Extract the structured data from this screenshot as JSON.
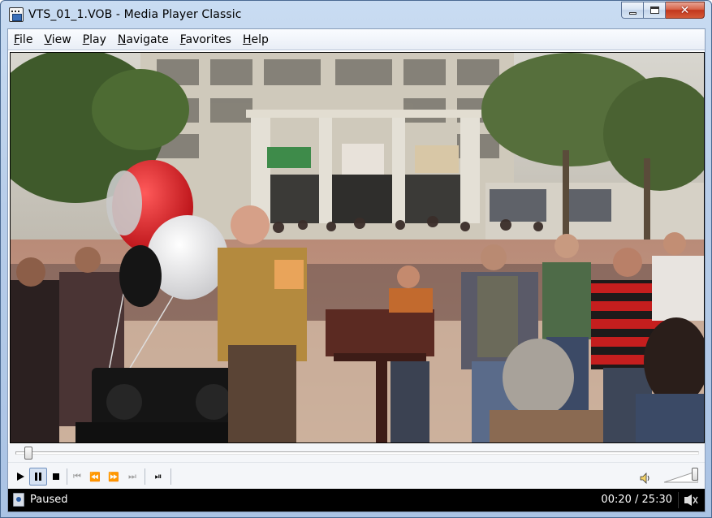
{
  "window": {
    "title": "VTS_01_1.VOB - Media Player Classic"
  },
  "menu": [
    {
      "label_acc": "F",
      "label_rest": "ile"
    },
    {
      "label_acc": "V",
      "label_rest": "iew"
    },
    {
      "label_acc": "P",
      "label_rest": "lay"
    },
    {
      "label_acc": "N",
      "label_rest": "avigate"
    },
    {
      "label_acc": "F",
      "label_rest": "avorites"
    },
    {
      "label_acc": "H",
      "label_rest": "elp"
    }
  ],
  "playback": {
    "state": "Paused",
    "position_text": "00:20 / 25:30",
    "position_fraction": 0.013,
    "volume_fraction": 1.0
  },
  "toolbar": {
    "buttons": [
      {
        "icon": "play-icon",
        "enabled": true,
        "pressed": false
      },
      {
        "icon": "pause-icon",
        "enabled": true,
        "pressed": true
      },
      {
        "icon": "stop-icon",
        "enabled": true,
        "pressed": false
      },
      {
        "icon": "skip-back-icon",
        "enabled": false,
        "pressed": false
      },
      {
        "icon": "rewind-icon",
        "enabled": true,
        "pressed": false
      },
      {
        "icon": "fast-forward-icon",
        "enabled": true,
        "pressed": false
      },
      {
        "icon": "skip-forward-icon",
        "enabled": false,
        "pressed": false
      },
      {
        "icon": "frame-step-icon",
        "enabled": true,
        "pressed": false
      }
    ]
  },
  "colors": {
    "close_button": "#c2361c",
    "status_bar": "#000000",
    "pressed_button": "#d6e2f2"
  }
}
